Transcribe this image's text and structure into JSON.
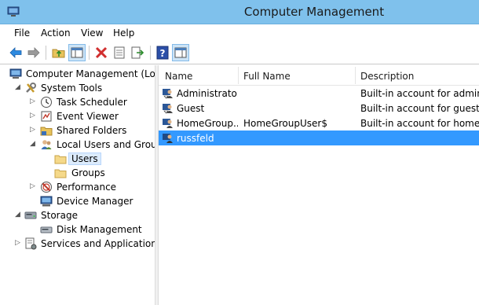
{
  "window": {
    "title": "Computer Management"
  },
  "menu": [
    "File",
    "Action",
    "View",
    "Help"
  ],
  "toolbar": {
    "buttons": [
      "back-arrow-icon",
      "forward-arrow-icon",
      "up-folder-icon",
      "show-hide-tree-icon",
      "delete-icon",
      "properties-icon",
      "export-icon",
      "help-icon",
      "show-action-pane-icon"
    ]
  },
  "tree": {
    "root": "Computer Management (Local",
    "system_tools": "System Tools",
    "task_scheduler": "Task Scheduler",
    "event_viewer": "Event Viewer",
    "shared_folders": "Shared Folders",
    "local_users": "Local Users and Groups",
    "users": "Users",
    "groups": "Groups",
    "performance": "Performance",
    "device_manager": "Device Manager",
    "storage": "Storage",
    "disk_management": "Disk Management",
    "services": "Services and Applications"
  },
  "list": {
    "columns": [
      "Name",
      "Full Name",
      "Description"
    ],
    "rows": [
      {
        "name": "Administrator",
        "full_name": "",
        "description": "Built-in account for adminis"
      },
      {
        "name": "Guest",
        "full_name": "",
        "description": "Built-in account for guest ac"
      },
      {
        "name": "HomeGroup...",
        "full_name": "HomeGroupUser$",
        "description": "Built-in account for homegr"
      },
      {
        "name": "russfeld",
        "full_name": "",
        "description": ""
      }
    ],
    "selected_row": "russfeld"
  },
  "colors": {
    "titlebar": "#7fc1ec",
    "selection": "#3399ff"
  }
}
